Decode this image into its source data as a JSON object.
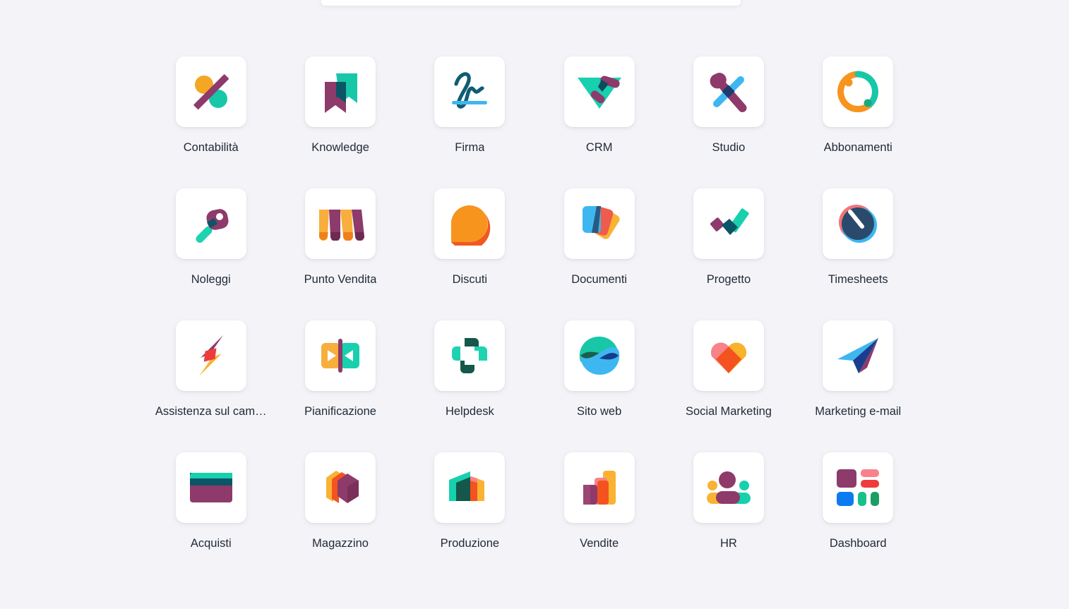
{
  "page": {
    "background_color": "#f4f4f8",
    "card_color": "#ffffff",
    "label_color": "#1f2937"
  },
  "top_bar": {
    "visible_sliver": true
  },
  "apps": [
    {
      "label": "Contabilità",
      "icon": "accounting-icon",
      "colors": [
        "#f5a623",
        "#8e3a6b",
        "#17c7a8"
      ]
    },
    {
      "label": "Knowledge",
      "icon": "knowledge-icon",
      "colors": [
        "#1dd3b0",
        "#8e3a6b",
        "#0b5566"
      ]
    },
    {
      "label": "Firma",
      "icon": "sign-icon",
      "colors": [
        "#0f5d73",
        "#3eb7f0"
      ]
    },
    {
      "label": "CRM",
      "icon": "crm-icon",
      "colors": [
        "#17d0ae",
        "#8e3a6b",
        "#0f4a5c"
      ]
    },
    {
      "label": "Studio",
      "icon": "studio-icon",
      "colors": [
        "#8e3a6b",
        "#3eb7f0",
        "#1b3d6e"
      ]
    },
    {
      "label": "Abbonamenti",
      "icon": "subscriptions-icon",
      "colors": [
        "#f7941e",
        "#19a97f",
        "#17c7a8"
      ]
    },
    {
      "label": "Noleggi",
      "icon": "rental-icon",
      "colors": [
        "#8e3a6b",
        "#1dd3b0",
        "#0b5566"
      ]
    },
    {
      "label": "Punto Vendita",
      "icon": "point-of-sale-icon",
      "colors": [
        "#f8ae3c",
        "#8e3a6b",
        "#f07f1a"
      ]
    },
    {
      "label": "Discuti",
      "icon": "discuss-icon",
      "colors": [
        "#f7941e",
        "#f1581f"
      ]
    },
    {
      "label": "Documenti",
      "icon": "documents-icon",
      "colors": [
        "#3eb7f0",
        "#f9b233",
        "#ef5b4c",
        "#2a5a82"
      ]
    },
    {
      "label": "Progetto",
      "icon": "project-icon",
      "colors": [
        "#17d0ae",
        "#8e3a6b",
        "#0b5566"
      ]
    },
    {
      "label": "Timesheets",
      "icon": "timesheets-icon",
      "colors": [
        "#2a4a6b",
        "#f4737a",
        "#3eb7f0"
      ]
    },
    {
      "label": "Assistenza sul cam…",
      "icon": "field-service-icon",
      "colors": [
        "#8e3a6b",
        "#f9b233",
        "#ef3b3b"
      ]
    },
    {
      "label": "Pianificazione",
      "icon": "planning-icon",
      "colors": [
        "#f8ae3c",
        "#17d0ae",
        "#8e3a6b"
      ]
    },
    {
      "label": "Helpdesk",
      "icon": "helpdesk-icon",
      "colors": [
        "#1dd3b0",
        "#15574b"
      ]
    },
    {
      "label": "Sito web",
      "icon": "website-icon",
      "colors": [
        "#17c7a8",
        "#1b5e4a",
        "#3eb7f0",
        "#143b8c"
      ]
    },
    {
      "label": "Social Marketing",
      "icon": "social-marketing-icon",
      "colors": [
        "#f9828a",
        "#f7b32b",
        "#f4531f"
      ]
    },
    {
      "label": "Marketing e-mail",
      "icon": "email-marketing-icon",
      "colors": [
        "#3eb7f0",
        "#1b3d8f",
        "#8e3a6b"
      ]
    },
    {
      "label": "Acquisti",
      "icon": "purchase-icon",
      "colors": [
        "#17d0ae",
        "#0b5566",
        "#8e3a6b"
      ]
    },
    {
      "label": "Magazzino",
      "icon": "inventory-icon",
      "colors": [
        "#f9b233",
        "#f4531f",
        "#8e3a6b"
      ]
    },
    {
      "label": "Produzione",
      "icon": "manufacturing-icon",
      "colors": [
        "#17d0ae",
        "#15574b",
        "#f9828a",
        "#f4531f",
        "#f9b233"
      ]
    },
    {
      "label": "Vendite",
      "icon": "sales-icon",
      "colors": [
        "#8e3a6b",
        "#f9828a",
        "#f4531f",
        "#f9b233"
      ]
    },
    {
      "label": "HR",
      "icon": "employees-icon",
      "colors": [
        "#8e3a6b",
        "#f9b233",
        "#17d0ae"
      ]
    },
    {
      "label": "Dashboard",
      "icon": "dashboard-icon",
      "colors": [
        "#8e3a6b",
        "#f9828a",
        "#ef3b3b",
        "#0d7bf0",
        "#17c18a",
        "#1a9e63"
      ]
    }
  ]
}
